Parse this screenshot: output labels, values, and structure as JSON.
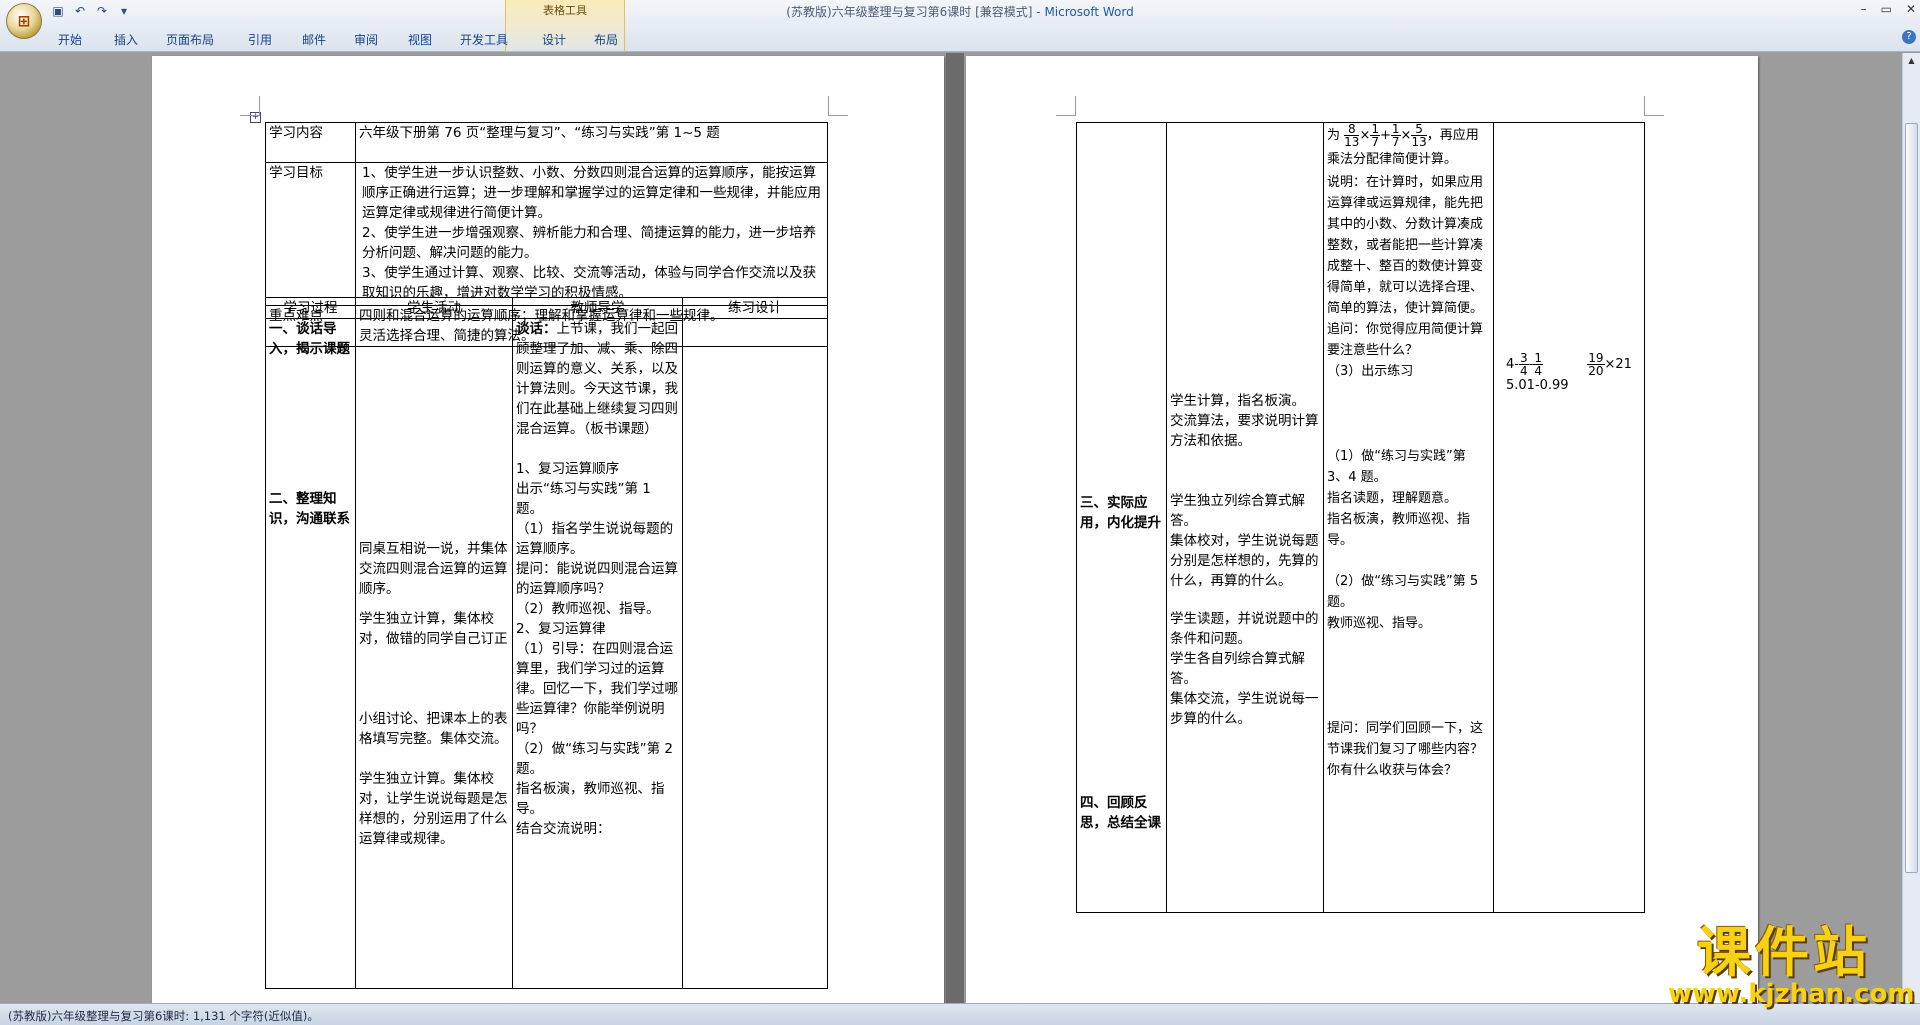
{
  "window": {
    "title_doc": "(苏教版)六年级整理与复习第6课时 [兼容模式]",
    "title_sep": "-",
    "title_app": "Microsoft Word",
    "controls": [
      "–",
      "▭",
      "✕"
    ]
  },
  "ribbon": {
    "contextual_label": "表格工具",
    "tabs": [
      "开始",
      "插入",
      "页面布局",
      "引用",
      "邮件",
      "审阅",
      "视图",
      "开发工具",
      "设计",
      "布局"
    ],
    "help": "?"
  },
  "page1": {
    "r1_label": "学习内容",
    "r1_content": "六年级下册第 76 页“整理与复习”、“练习与实践”第 1~5 题",
    "r2_label": "学习目标",
    "r2_items": [
      "1、使学生进一步认识整数、小数、分数四则混合运算的运算顺序，能按运算顺序正确进行运算；进一步理解和掌握学过的运算定律和一些规律，并能应用运算定律或规律进行简便计算。",
      "2、使学生进一步增强观察、辨析能力和合理、简捷运算的能力，进一步培养分析问题、解决问题的能力。",
      "3、使学生通过计算、观察、比较、交流等活动，体验与同学合作交流以及获取知识的乐趣，增进对数学学习的积极情感。"
    ],
    "r3_label": "重点难点",
    "r3_line1": "四则和混合运算的运算顺序；理解和掌握运算律和一些规律。",
    "r3_line2": "灵活选择合理、简捷的算法。",
    "headers": [
      "学习过程",
      "学生活动",
      "教师导学",
      "练习设计"
    ],
    "col1_s1": "一、谈话导入，揭示课题",
    "col1_s2": "二、整理知识，沟通联系",
    "col2_a": "同桌互相说一说，并集体交流四则混合运算的运算顺序。",
    "col2_b": "学生独立计算，集体校对，做错的同学自己订正",
    "col2_c": "小组讨论、把课本上的表格填写完整。集体交流。",
    "col2_d": "学生独立计算。集体校对，让学生说说每题是怎样想的，分别运用了什么运算律或规律。",
    "col3_a_bold": "谈话：",
    "col3_a": "上节课，我们一起回顾整理了加、减、乘、除四则运算的意义、关系，以及计算法则。今天这节课，我们在此基础上继续复习四则混合运算。（板书课题）",
    "col3_b": "1、复习运算顺序\n出示“练习与实践”第 1 题。\n（1）指名学生说说每题的运算顺序。\n提问：能说说四则混合运算的运算顺序吗？\n（2）教师巡视、指导。\n2、复习运算律\n（1）引导：在四则混合运算里，我们学习过的运算律。回忆一下，我们学过哪些运算律？你能举例说明吗？\n（2）做“练习与实践”第 2 题。\n指名板演，教师巡视、指导。\n结合交流说明："
  },
  "page2": {
    "col3_top_prefix": "为",
    "col3_top_suffix": "，再应用乘法分配律简便计算。",
    "col3_note": "说明：在计算时，如果应用运算律或运算规律，能先把其中的小数、分数计算凑成整数，或者能把一些计算凑成整十、整百的数使计算变得简单，就可以选择合理、简单的算法，使计算简便。\n追问：你觉得应用简便计算要注意些什么？\n（3）出示练习",
    "col2_a": "学生计算，指名板演。\n交流算法，要求说明计算方法和依据。",
    "col1_s3": "三、实际应用，内化提升",
    "col2_b": "学生独立列综合算式解答。\n集体校对，学生说说每题分别是怎样想的，先算的什么，再算的什么。",
    "col3_b": "（1）做“练习与实践”第 3、4 题。\n指名读题，理解题意。\n指名板演，教师巡视、指导。",
    "col2_c": "学生读题，并说说题中的条件和问题。\n学生各自列综合算式解答。\n集体交流，学生说说每一步算的什么。",
    "col3_c": "（2）做“练习与实践”第 5 题。\n教师巡视、指导。",
    "col1_s4": "四、回顾反思，总结全课",
    "col3_d": "提问：同学们回顾一下，这节课我们复习了哪些内容？你有什么收获与体会？",
    "exercise_line2": "5.01-0.99",
    "fracs": {
      "f1n": "8",
      "f1d": "13",
      "f2n": "1",
      "f2d": "7",
      "f3n": "1",
      "f3d": "7",
      "f4n": "5",
      "f4d": "13",
      "e1": "4-",
      "e1fn": "3",
      "e1fd": "4",
      "e2": "-",
      "e2fn": "1",
      "e2fd": "4",
      "e3fn": "19",
      "e3fd": "20",
      "e3": "×21"
    },
    "ops": {
      "times": "×",
      "plus": "+"
    }
  },
  "status": {
    "text": "(苏教版)六年级整理与复习第6课时: 1,131 个字符(近似值)。"
  },
  "watermark": {
    "line1": "课件站",
    "line2": "www.kjzhan.com"
  }
}
